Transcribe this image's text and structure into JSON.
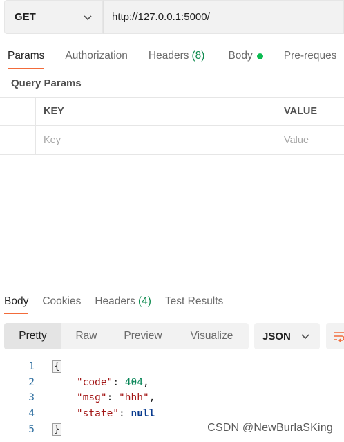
{
  "request": {
    "method": "GET",
    "url": "http://127.0.0.1:5000/"
  },
  "request_tabs": [
    {
      "label": "Params",
      "active": true
    },
    {
      "label": "Authorization"
    },
    {
      "label": "Headers",
      "count": "(8)"
    },
    {
      "label": "Body",
      "dot": true
    },
    {
      "label": "Pre-reques"
    }
  ],
  "params": {
    "title": "Query Params",
    "columns": {
      "key": "KEY",
      "value": "VALUE"
    },
    "placeholder": {
      "key": "Key",
      "value": "Value"
    }
  },
  "response_tabs": [
    {
      "label": "Body",
      "active": true
    },
    {
      "label": "Cookies"
    },
    {
      "label": "Headers",
      "count": "(4)"
    },
    {
      "label": "Test Results"
    }
  ],
  "format": {
    "buttons": [
      "Pretty",
      "Raw",
      "Preview",
      "Visualize"
    ],
    "active": "Pretty",
    "language": "JSON"
  },
  "response_body": {
    "line_numbers": [
      "1",
      "2",
      "3",
      "4",
      "5"
    ],
    "open": "{",
    "close": "}",
    "entries": [
      {
        "key": "\"code\"",
        "value": "404",
        "kind": "number",
        "comma": ","
      },
      {
        "key": "\"msg\"",
        "value": "\"hhh\"",
        "kind": "string",
        "comma": ","
      },
      {
        "key": "\"state\"",
        "value": "null",
        "kind": "null",
        "comma": ""
      }
    ]
  },
  "watermark": "CSDN @NewBurlaSKing",
  "colors": {
    "accent": "#f26b3a",
    "green": "#0cbb52",
    "count_green": "#0c8a4d"
  }
}
